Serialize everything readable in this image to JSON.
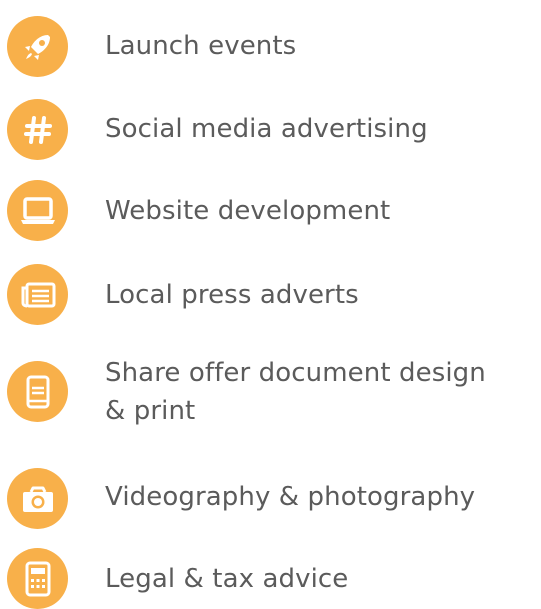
{
  "colors": {
    "icon_bg": "#f8b04a",
    "icon_fg": "#ffffff",
    "text": "#5b5b5b"
  },
  "items": [
    {
      "label": "Launch events",
      "icon": "rocket-icon"
    },
    {
      "label": "Social media advertising",
      "icon": "hashtag-icon"
    },
    {
      "label": "Website development",
      "icon": "laptop-icon"
    },
    {
      "label": "Local press adverts",
      "icon": "newspaper-icon"
    },
    {
      "label_line1": "Share offer document design",
      "label_line2": "& print",
      "icon": "book-icon"
    },
    {
      "label": "Videography & photography",
      "icon": "camera-icon"
    },
    {
      "label": "Legal & tax advice",
      "icon": "calculator-icon"
    }
  ]
}
